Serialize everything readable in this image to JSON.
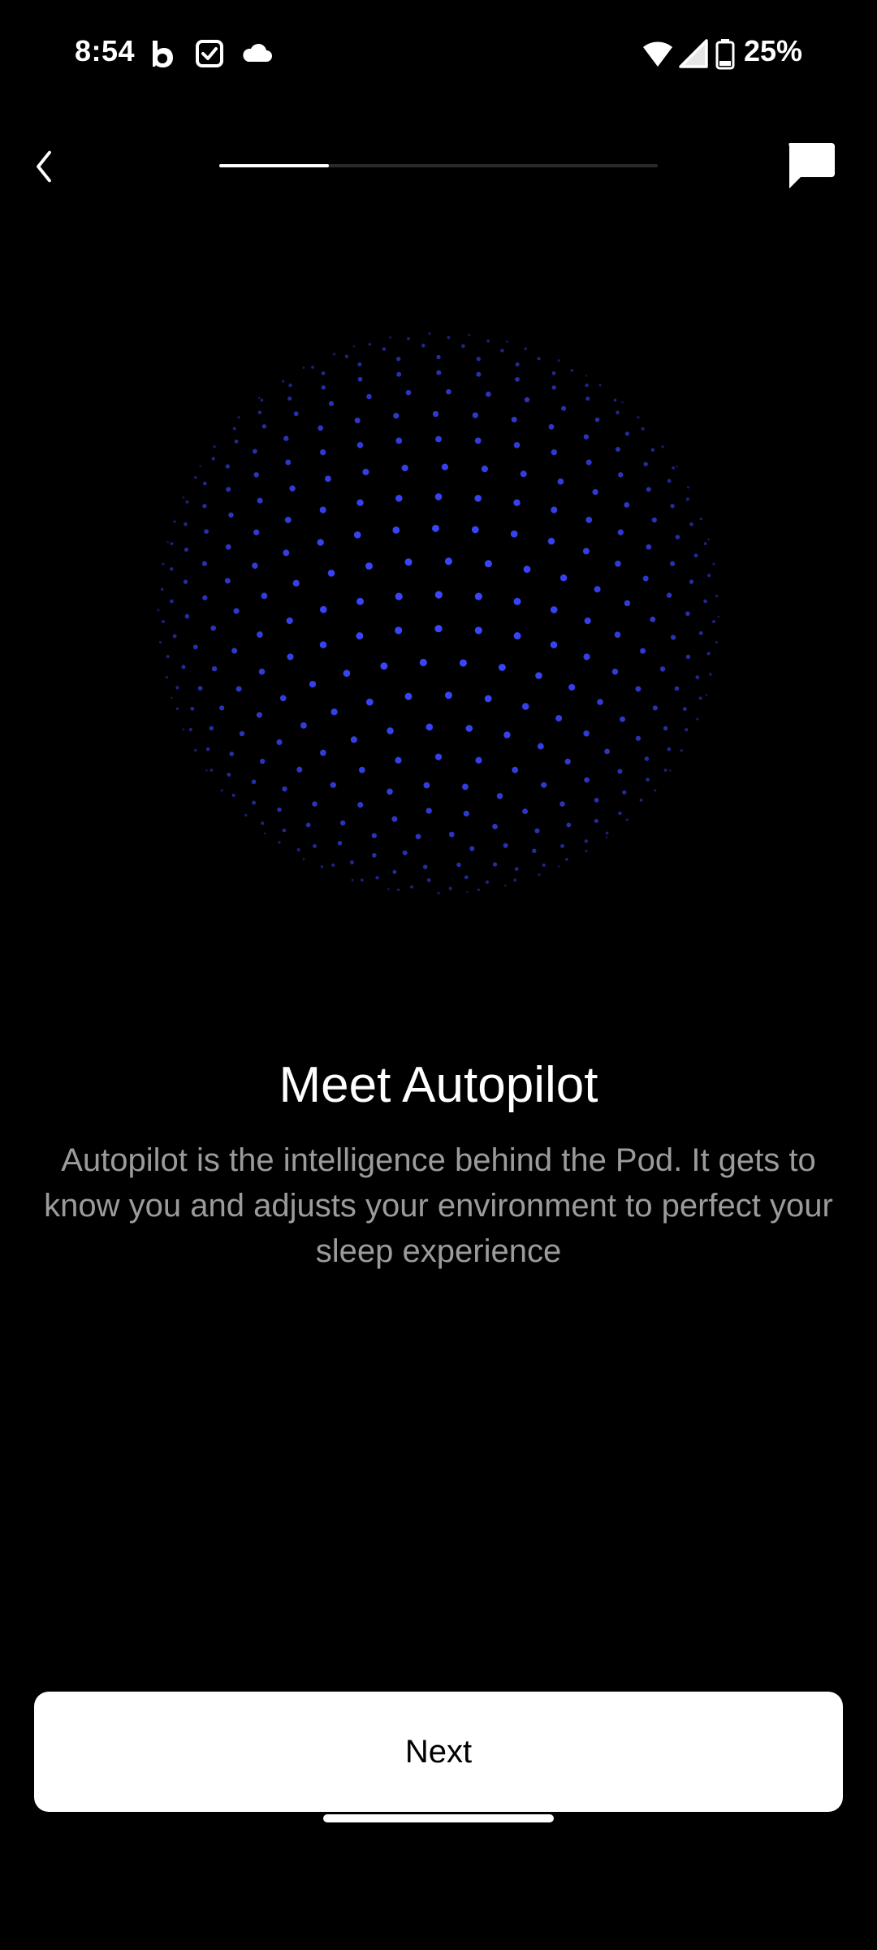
{
  "status_bar": {
    "time": "8:54",
    "battery_percent": "25%",
    "icons": [
      "bluesky-b-icon",
      "checkbox-icon",
      "cloud-icon",
      "wifi-icon",
      "cellular-signal-icon",
      "battery-icon"
    ]
  },
  "nav": {
    "back_icon": "chevron-left-icon",
    "chat_icon": "chat-bubble-icon",
    "progress": 0.25
  },
  "content": {
    "title": "Meet Autopilot",
    "description": "Autopilot is the intelligence behind the Pod. It gets to know you and adjusts your environment to perfect your sleep experience"
  },
  "actions": {
    "next_label": "Next"
  },
  "colors": {
    "background": "#000000",
    "accent_dots": "#3a46ff",
    "text_secondary": "#9b9b9b",
    "button_bg": "#ffffff"
  }
}
